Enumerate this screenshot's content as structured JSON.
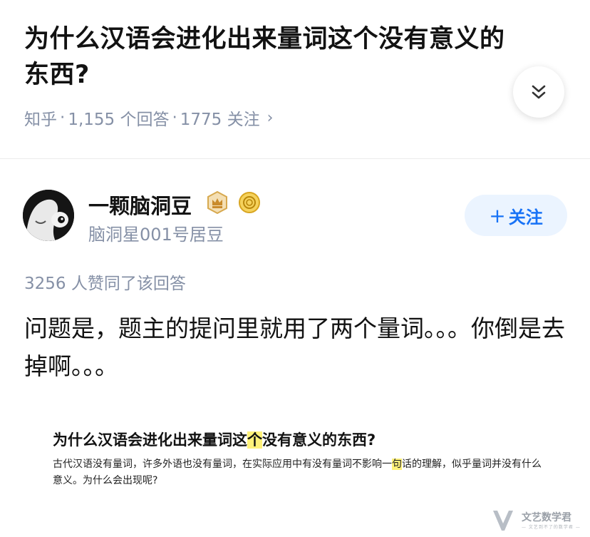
{
  "question": {
    "title": "为什么汉语会进化出来量词这个没有意义的东西?",
    "source": "知乎",
    "answers": "1,155 个回答",
    "followers": "1775 关注",
    "separator": "·",
    "chevron": "›"
  },
  "collapse_icon": "double-chevron-down-icon",
  "author": {
    "name": "一颗脑洞豆",
    "bio": "脑洞星001号居豆",
    "badges": [
      "crown-badge-icon",
      "coin-badge-icon"
    ]
  },
  "follow_button": {
    "plus": "+",
    "label": "关注"
  },
  "votes": "3256 人赞同了该回答",
  "answer": {
    "text": "问题是，题主的提问里就用了两个量词。。。你倒是去掉啊。。。"
  },
  "quoted_image": {
    "title_part1": "为什么汉语会进化出来量词这",
    "title_hl": "个",
    "title_part2": "没有意义的东西?",
    "body_part1": "古代汉语没有量词，许多外语也没有量词，在实际应用中有没有量词不影响一",
    "body_hl": "句",
    "body_part2": "话的理解，似乎量词并没有什么意义。为什么会出现呢?"
  },
  "watermark": {
    "name": "文艺数学君",
    "sub": "— 文艺到不了的数学君 —"
  },
  "colors": {
    "accent": "#1772f6",
    "muted": "#8590a6",
    "highlight": "#fff27a",
    "follow_bg": "#ebf4ff"
  }
}
